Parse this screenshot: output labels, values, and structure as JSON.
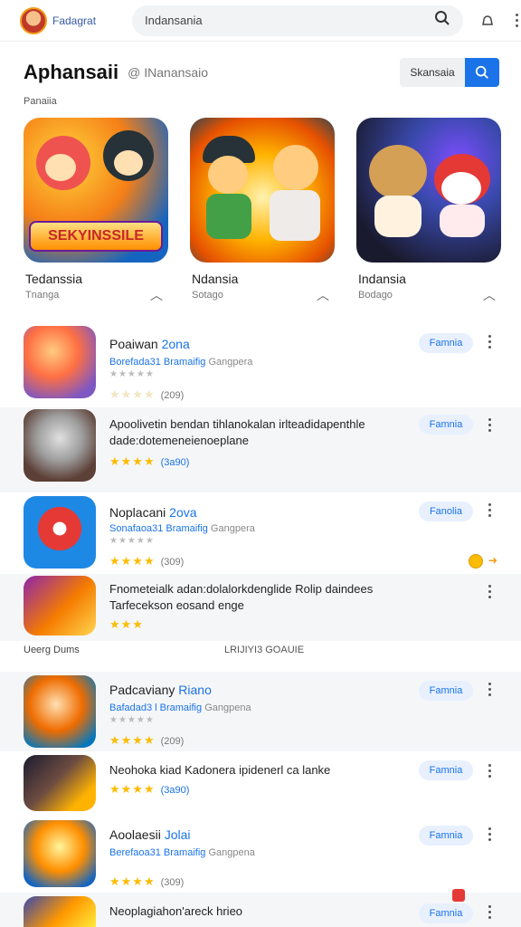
{
  "topbar": {
    "brand": "Fadagrat",
    "search_text": "Indansania"
  },
  "header": {
    "title": "Aphansaii",
    "subtitle": "@ INanansaio",
    "search_field": "Skansaia",
    "section_label": "Panaiia"
  },
  "featured": [
    {
      "name": "Tedanssia",
      "category": "Tnanga",
      "banner": "SEKYINSSILE"
    },
    {
      "name": "Ndansia",
      "category": "Sotago"
    },
    {
      "name": "Indansia",
      "category": "Bodago"
    }
  ],
  "list": [
    {
      "title": "Poaiwan",
      "title_hl": "2ona",
      "meta_blue": "Borefada31 Bramaifig",
      "meta_gray": "Gangpera",
      "stars": "★★★★",
      "count": "(209)",
      "button": "Famnia"
    },
    {
      "title_long": "Apoolivetin bendan tihlanokalan irlteadidapenthle dade:dotemeneienoeplane",
      "stars": "★★★★",
      "count": "(3a90)",
      "button": "Famnia"
    },
    {
      "title": "Noplacani",
      "title_hl": "2ova",
      "meta_blue": "Sonafaoa31 Bramaifig",
      "meta_gray": "Gangpera",
      "stars": "★★★★",
      "count": "(309)",
      "button": "Fanolia"
    },
    {
      "title_long": "Fnometeialk adan:dolalorkdenglide Rolip daindees Tarfecekson eosand enge",
      "stars": "★★★",
      "count": ""
    },
    {
      "title": "Padcaviany",
      "title_hl": "Riano",
      "meta_blue": "Bafadad3 l Bramaifig",
      "meta_gray": "Gangpena",
      "stars": "★★★★",
      "count": "(209)",
      "button": "Famnia"
    },
    {
      "title_long": "Neohoka kiad Kadonera ipidenerl ca lanke",
      "stars": "★★★★",
      "count": "(3a90)",
      "button": "Famnia"
    },
    {
      "title": "Aoolaesii",
      "title_hl": "Jolai",
      "meta_blue": "Berefaoa31 Bramaifig",
      "meta_gray": "Gangpena",
      "stars": "★★★★",
      "count": "(309)",
      "button": "Famnia"
    },
    {
      "title_long": "Neoplagiahon'areck hrieo",
      "button": "Famnia"
    }
  ],
  "subsection": {
    "left": "Ueerg Dums",
    "right": "LRIJIYI3 GOAUIE"
  },
  "colors": {
    "accent": "#1a73e8",
    "star": "#fbbc04",
    "pill_bg": "#e8f0fe"
  }
}
